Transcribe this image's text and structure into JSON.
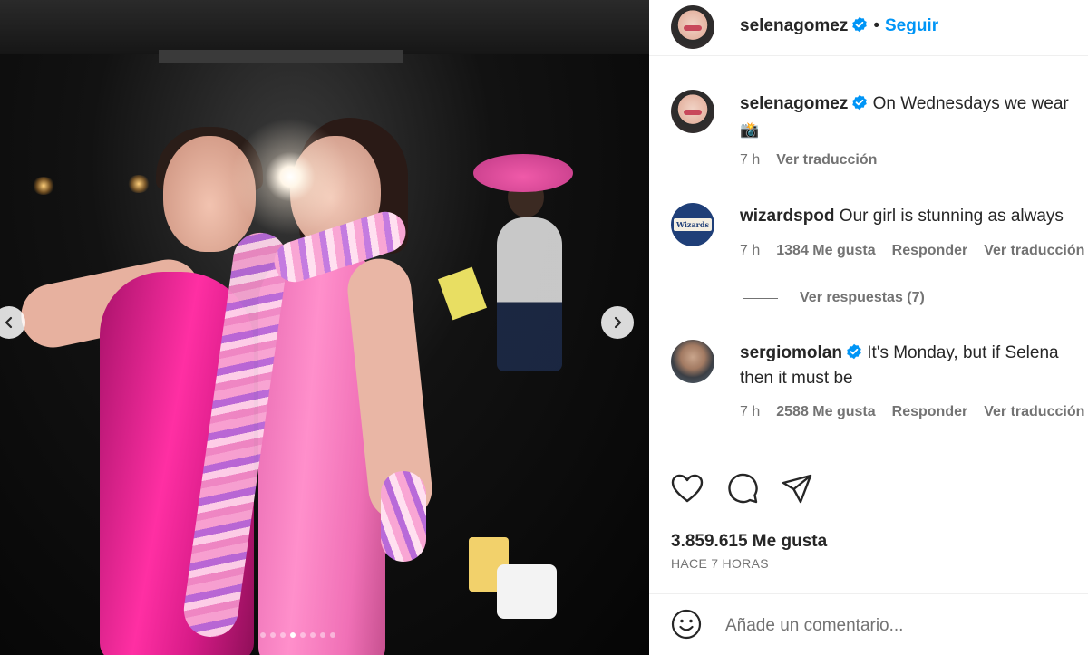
{
  "header": {
    "username": "selenagomez",
    "separator": "•",
    "follow_label": "Seguir"
  },
  "caption": {
    "username": "selenagomez",
    "text": "On Wednesdays we wear",
    "emoji": "📸",
    "time": "7 h",
    "translate_label": "Ver traducción"
  },
  "comments": [
    {
      "username": "wizardspod",
      "avatar_text": "Wizards",
      "text": "Our girl is stunning as always",
      "time": "7 h",
      "likes": "1384 Me gusta",
      "reply_label": "Responder",
      "translate_label": "Ver traducción"
    },
    {
      "username": "sergiomolan",
      "text_line1": "It's Monday, but if Selena",
      "text_line2": "then it must be",
      "time": "7 h",
      "likes": "2588 Me gusta",
      "reply_label": "Responder",
      "translate_label": "Ver traducción"
    }
  ],
  "view_replies_label": "Ver respuestas (7)",
  "post": {
    "likes": "3.859.615 Me gusta",
    "time_ago": "HACE 7 HORAS",
    "comment_placeholder": "Añade un comentario..."
  },
  "media": {
    "prev_icon": "chevron-left-icon",
    "next_icon": "chevron-right-icon",
    "slide_count": 8,
    "active_slide": 4
  },
  "colors": {
    "accent": "#0095f6",
    "verified": "#0095f6",
    "text": "#262626",
    "secondary": "#737373"
  }
}
